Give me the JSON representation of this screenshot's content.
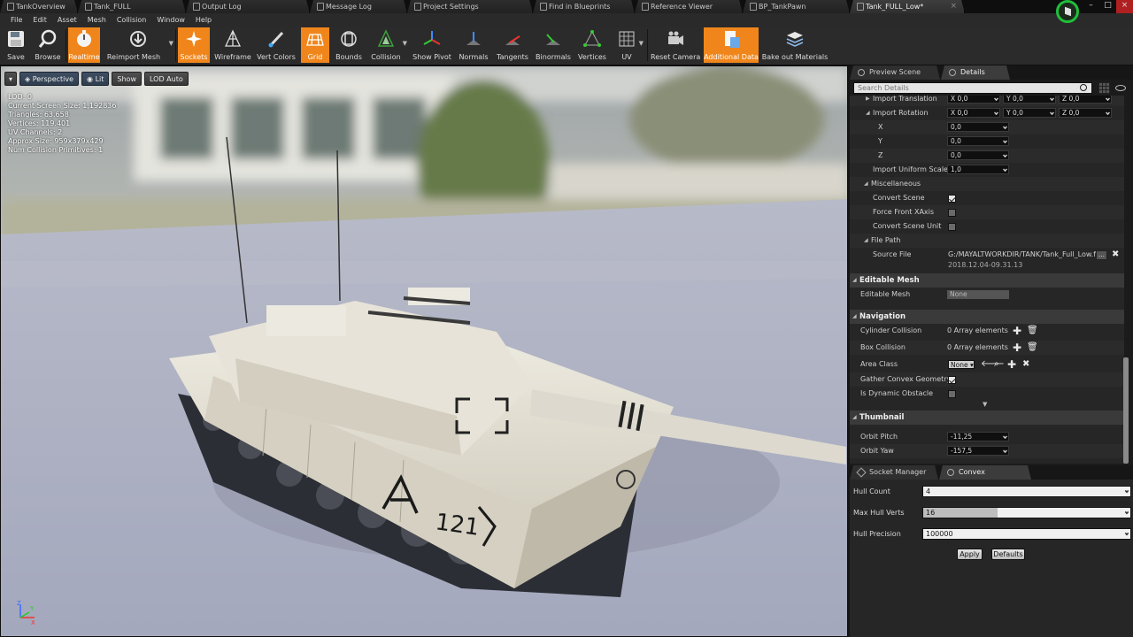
{
  "tabs": [
    {
      "label": "TankOverview",
      "active": false
    },
    {
      "label": "Tank_FULL",
      "active": false
    },
    {
      "label": "Output Log",
      "active": false
    },
    {
      "label": "Message Log",
      "active": false
    },
    {
      "label": "Project Settings",
      "active": false
    },
    {
      "label": "Find in Blueprints",
      "active": false
    },
    {
      "label": "Reference Viewer",
      "active": false
    },
    {
      "label": "BP_TankPawn",
      "active": false
    },
    {
      "label": "Tank_FULL_Low*",
      "active": true
    }
  ],
  "menu": [
    "File",
    "Edit",
    "Asset",
    "Mesh",
    "Collision",
    "Window",
    "Help"
  ],
  "toolbar": {
    "save": "Save",
    "browse": "Browse",
    "realtime": "Realtime",
    "reimport": "Reimport Mesh",
    "sockets": "Sockets",
    "wireframe": "Wireframe",
    "vert_colors": "Vert Colors",
    "grid": "Grid",
    "bounds": "Bounds",
    "collision": "Collision",
    "show_pivot": "Show Pivot",
    "normals": "Normals",
    "tangents": "Tangents",
    "binormals": "Binormals",
    "vertices": "Vertices",
    "uv": "UV",
    "reset_camera": "Reset Camera",
    "additional_data": "Additional Data",
    "bake_out": "Bake out Materials"
  },
  "viewport": {
    "perspective": "Perspective",
    "lit": "Lit",
    "show": "Show",
    "lod": "LOD Auto",
    "stats": [
      "LOD:  0",
      "Current Screen Size:  1,192836",
      "Triangles:  63.658",
      "Vertices:  119.401",
      "UV Channels:  2",
      "Approx Size: 959x379x429",
      "Num Collision Primitives:  1"
    ],
    "axis": {
      "x": "X",
      "y": "Y",
      "z": "Z"
    },
    "tank_number": "121"
  },
  "panel": {
    "tab_preview": "Preview Scene Sett",
    "tab_details": "Details",
    "search_placeholder": "Search Details",
    "import_translation": "Import Translation",
    "import_rotation": "Import Rotation",
    "x_tag": "X",
    "y_tag": "Y",
    "z_tag": "Z",
    "zero": "0,0",
    "rot_x": "X",
    "rot_y": "Y",
    "rot_z": "Z",
    "import_uniform_scale": "Import Uniform Scale",
    "uniform_scale_value": "1,0",
    "misc": "Miscellaneous",
    "convert_scene": "Convert Scene",
    "force_front_xaxis": "Force Front XAxis",
    "convert_scene_unit": "Convert Scene Unit",
    "file_path": "File Path",
    "source_file": "Source File",
    "source_file_value": "G:/MAYALTWORKDIR/TANK/Tank_Full_Low.fbx",
    "source_file_date": "2018.12.04-09.31.13",
    "editable_mesh_cat": "Editable Mesh",
    "editable_mesh": "Editable Mesh",
    "editable_mesh_value": "None",
    "navigation": "Navigation",
    "cylinder_collision": "Cylinder Collision",
    "array_elements": "0 Array elements",
    "box_collision": "Box Collision",
    "area_class": "Area Class",
    "area_class_value": "None",
    "gather_convex": "Gather Convex Geometry",
    "is_dynamic": "Is Dynamic Obstacle",
    "thumbnail": "Thumbnail",
    "orbit_pitch": "Orbit Pitch",
    "orbit_pitch_value": "-11,25",
    "orbit_yaw": "Orbit Yaw",
    "orbit_yaw_value": "-157,5"
  },
  "bottom": {
    "tab_socket": "Socket Manager",
    "tab_convex": "Convex Decompos",
    "hull_count": "Hull Count",
    "hull_count_value": "4",
    "max_hull_verts": "Max Hull Verts",
    "max_hull_verts_value": "16",
    "max_hull_verts_fill": 0.36,
    "hull_precision": "Hull Precision",
    "hull_precision_value": "100000",
    "apply": "Apply",
    "defaults": "Defaults"
  },
  "colors": {
    "accent": "#f0861b",
    "panel": "#262626",
    "ground": "#aeb3c6"
  }
}
